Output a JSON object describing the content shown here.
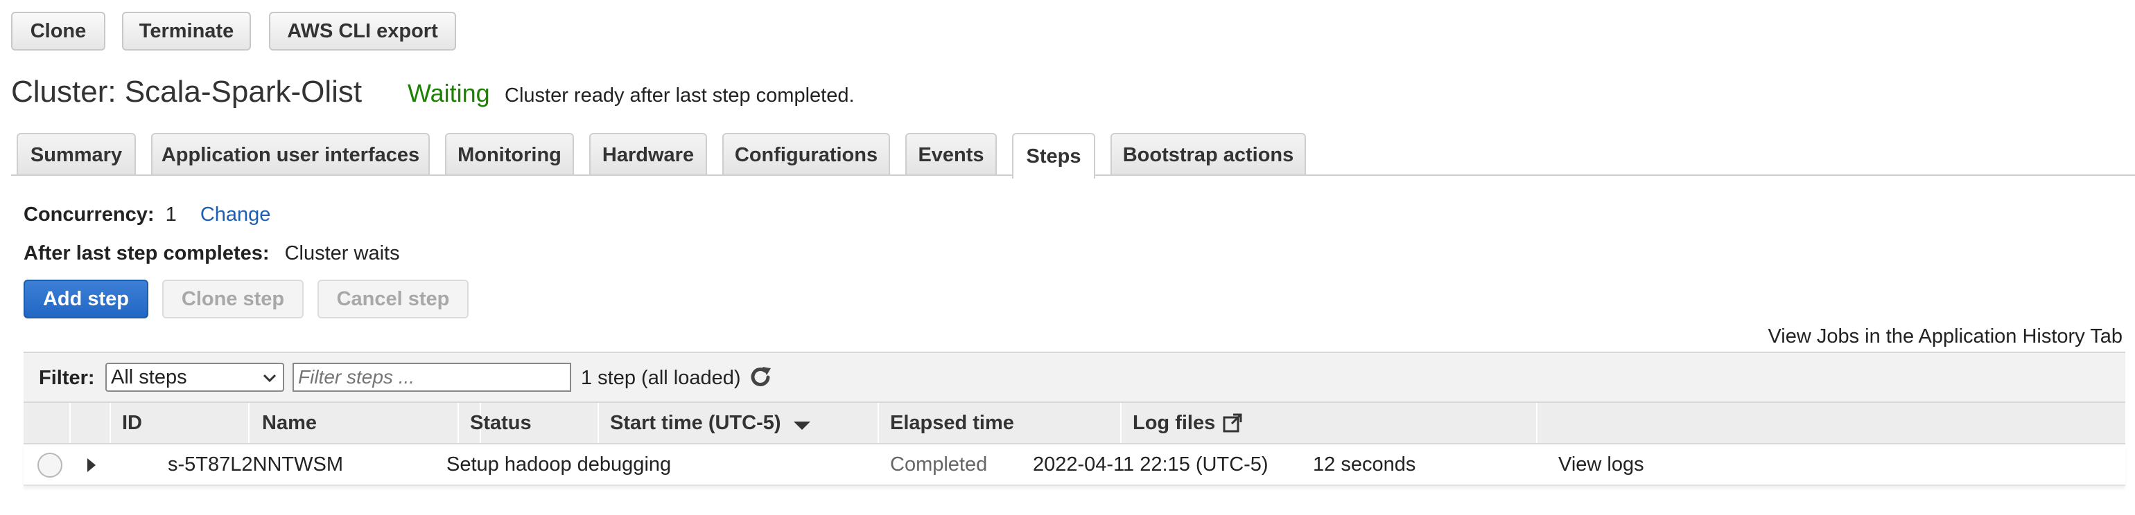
{
  "toolbar": {
    "clone": "Clone",
    "terminate": "Terminate",
    "aws_cli_export": "AWS CLI export"
  },
  "cluster": {
    "title": "Cluster: Scala-Spark-Olist",
    "state": "Waiting",
    "state_description": "Cluster ready after last step completed."
  },
  "tabs": [
    {
      "label": "Summary"
    },
    {
      "label": "Application user interfaces"
    },
    {
      "label": "Monitoring"
    },
    {
      "label": "Hardware"
    },
    {
      "label": "Configurations"
    },
    {
      "label": "Events"
    },
    {
      "label": "Steps",
      "active": true
    },
    {
      "label": "Bootstrap actions"
    }
  ],
  "steps": {
    "concurrency_label": "Concurrency:",
    "concurrency_value": "1",
    "change_link": "Change",
    "after_last_label": "After last step completes:",
    "after_last_value": "Cluster waits",
    "add_step": "Add step",
    "clone_step": "Clone step",
    "cancel_step": "Cancel step",
    "history_link": "View Jobs in the Application History Tab",
    "filter_label": "Filter:",
    "filter_selected": "All steps",
    "filter_placeholder": "Filter steps ...",
    "count_text": "1 step (all loaded)"
  },
  "table": {
    "columns": [
      "ID",
      "Name",
      "Status",
      "Start time (UTC-5)",
      "Elapsed time",
      "Log files"
    ],
    "rows": [
      {
        "id": "s-5T87L2NNTWSM",
        "name": "Setup hadoop debugging",
        "status": "Completed",
        "start_time": "2022-04-11 22:15 (UTC-5)",
        "elapsed": "12 seconds",
        "log_link": "View logs"
      }
    ]
  },
  "colors": {
    "accent": "#2167c4",
    "status_waiting": "#1d8102",
    "link": "#1a5fb4"
  }
}
